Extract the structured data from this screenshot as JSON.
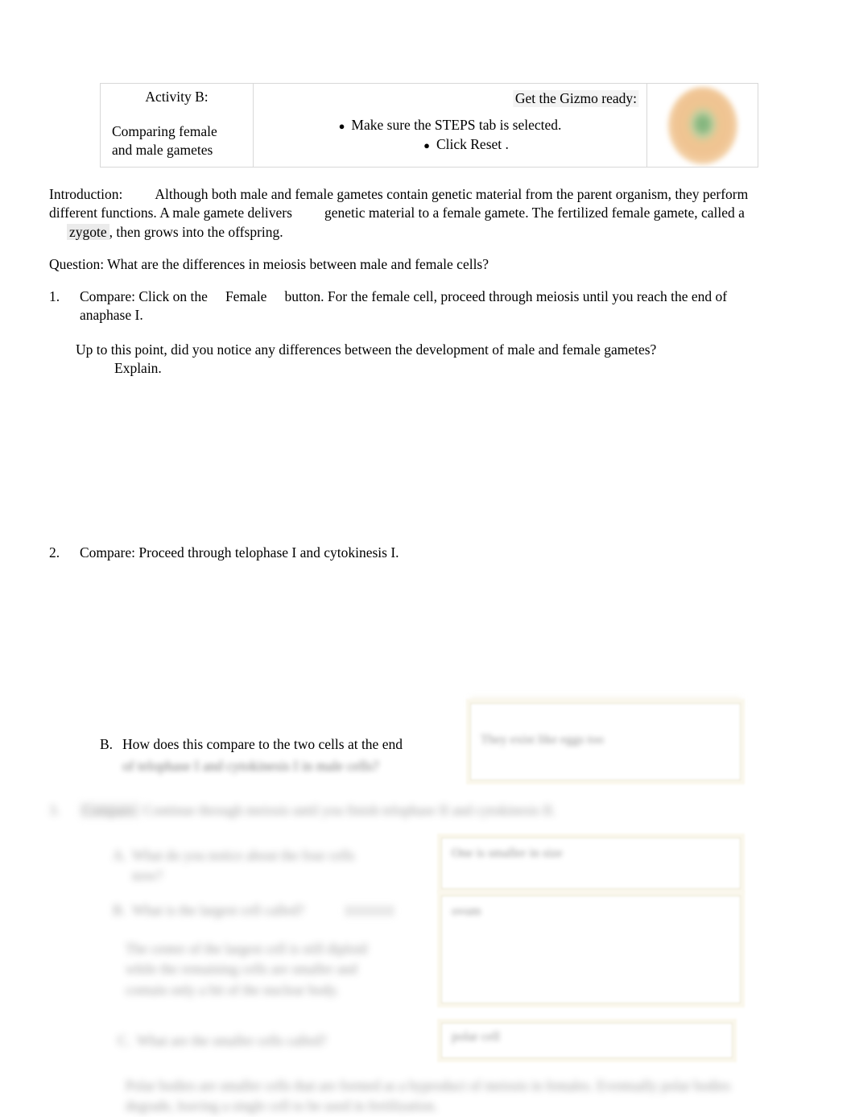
{
  "document": {
    "type": "worksheet",
    "title": "Activity B: Comparing female and male gametes"
  },
  "activity_table": {
    "title_cell": {
      "label": "Activity B:",
      "subtitle_line1": "Comparing female",
      "subtitle_line2": "and male gametes"
    },
    "instructions_cell": {
      "heading": "Get the Gizmo ready:",
      "bullets": [
        "Make sure the STEPS tab is selected.",
        "Click Reset ."
      ]
    },
    "image_cell": {
      "icon_name": "egg-cell-illustration",
      "outer_color": "#f0c493",
      "nucleus_color": "#7fb37a"
    }
  },
  "intro": {
    "label": "Introduction:",
    "text_part1": "Although both male and female gametes contain genetic material from the parent organism, they perform different functions. A male gamete delivers",
    "text_part2": "genetic material to a female gamete. The fertilized female gamete, called a",
    "highlighted_term": "zygote",
    "text_part3": ", then grows into the offspring."
  },
  "question_line": "Question: What are the differences in meiosis between male and female cells?",
  "items": [
    {
      "number": "1.",
      "lead": "Compare: Click on the",
      "button_ref": "Female",
      "rest": "button. For the female cell, proceed through meiosis until you reach the end of anaphase I.",
      "sub_prompt": "Up to this point, did you notice any differences between the development of male and female gametes?",
      "sub_prompt_tail": "Explain."
    },
    {
      "number": "2.",
      "text": "Compare: Proceed through telophase I and cytokinesis I."
    }
  ],
  "lower_blurred": {
    "question_b": {
      "marker": "B.",
      "line1": "How does this compare to the two cells at the end",
      "line2": "of telophase I and cytokinesis I in male cells?"
    },
    "item3": {
      "marker": "3.",
      "highlighted": "Compare:",
      "text": "Continue through meiosis until you finish telophase II and cytokinesis II."
    },
    "sub_a": {
      "marker": "A.",
      "line1": "What do you notice about the four cells",
      "line2": "now?"
    },
    "sub_b": {
      "marker": "B.",
      "text": "What is the largest cell called?",
      "answer_inline": "an ovum",
      "body": "The center of the largest cell is still diploid while the remaining cells are smaller and contain only a bit of the nuclear body."
    },
    "sub_c": {
      "marker": "C.",
      "text": "What are the smaller cells called?"
    },
    "final_text": "Polar bodies are smaller cells that are formed as a byproduct of meiosis in females. Eventually polar bodies degrade, leaving a single cell to be used in fertilization."
  },
  "answer_boxes": [
    {
      "name": "answer-box-top",
      "value": "They exist like eggs too"
    },
    {
      "name": "answer-box-a",
      "value": "One is smaller in size"
    },
    {
      "name": "answer-box-b",
      "value": "ovum"
    },
    {
      "name": "answer-box-c",
      "value": "polar cell"
    }
  ],
  "colors": {
    "page_background": "#ffffff",
    "text": "#000000",
    "table_border": "#d8d8d8",
    "highlight": "#ebebeb",
    "answer_box_border": "#e9e3cf",
    "answer_box_glow": "#faf7ec"
  }
}
